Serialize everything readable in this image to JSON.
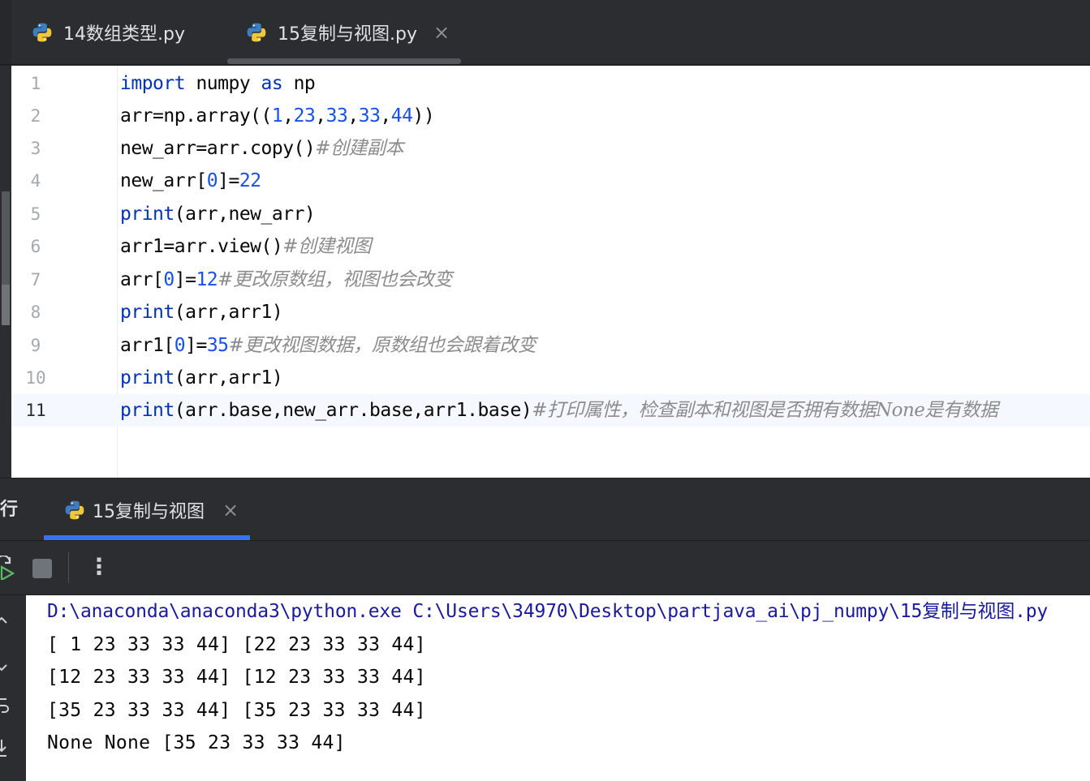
{
  "editor_tabs": [
    {
      "label": "14数组类型.py",
      "active": false
    },
    {
      "label": "15复制与视图.py",
      "active": true,
      "close": "×"
    }
  ],
  "code_lines": [
    {
      "n": "1"
    },
    {
      "n": "2"
    },
    {
      "n": "3"
    },
    {
      "n": "4"
    },
    {
      "n": "5"
    },
    {
      "n": "6"
    },
    {
      "n": "7"
    },
    {
      "n": "8"
    },
    {
      "n": "9"
    },
    {
      "n": "10"
    },
    {
      "n": "11"
    }
  ],
  "code": {
    "l1": {
      "a": "import",
      "b": " numpy ",
      "c": "as",
      "d": " np"
    },
    "l2": {
      "a": "arr=np.array((",
      "b": "1",
      "c": ",",
      "d": "23",
      "e": ",",
      "f": "33",
      "g": ",",
      "h": "33",
      "i": ",",
      "j": "44",
      "k": "))"
    },
    "l3": {
      "a": "new_arr=arr.copy()",
      "b": "#创建副本"
    },
    "l4": {
      "a": "new_arr[",
      "b": "0",
      "c": "]=",
      "d": "22"
    },
    "l5": {
      "a": "print",
      "b": "(arr,new_arr)"
    },
    "l6": {
      "a": "arr1=arr.view()",
      "b": "#创建视图"
    },
    "l7": {
      "a": "arr[",
      "b": "0",
      "c": "]=",
      "d": "12",
      "e": "#更改原数组，视图也会改变"
    },
    "l8": {
      "a": "print",
      "b": "(arr,arr1)"
    },
    "l9": {
      "a": "arr1[",
      "b": "0",
      "c": "]=",
      "d": "35",
      "e": "#更改视图数据，原数组也会跟着改变"
    },
    "l10": {
      "a": "print",
      "b": "(arr,arr1)"
    },
    "l11": {
      "a": "print",
      "b": "(arr.base,new_arr.base,arr1.base)",
      "c": "#打印属性，检查副本和视图是否拥有数据None是有数据"
    }
  },
  "run_panel": {
    "title": "运行",
    "tab_label": "15复制与视图",
    "tab_close": "×",
    "more": "⋮"
  },
  "console": {
    "command": "D:\\anaconda\\anaconda3\\python.exe C:\\Users\\34970\\Desktop\\partjava_ai\\pj_numpy\\15复制与视图.py",
    "lines": [
      "[ 1 23 33 33 44] [22 23 33 33 44]",
      "[12 23 33 33 44] [12 23 33 33 44]",
      "[35 23 33 33 44] [35 23 33 33 44]",
      "None None [35 23 33 33 44]"
    ]
  },
  "colors": {
    "keyword": "#0033b3",
    "number": "#1750eb",
    "comment": "#8c8c8c",
    "accent": "#3574f0"
  },
  "icons": {
    "python_file": "python-icon",
    "rerun": "rerun-icon",
    "stop": "stop-icon",
    "more": "more-vertical-icon"
  }
}
